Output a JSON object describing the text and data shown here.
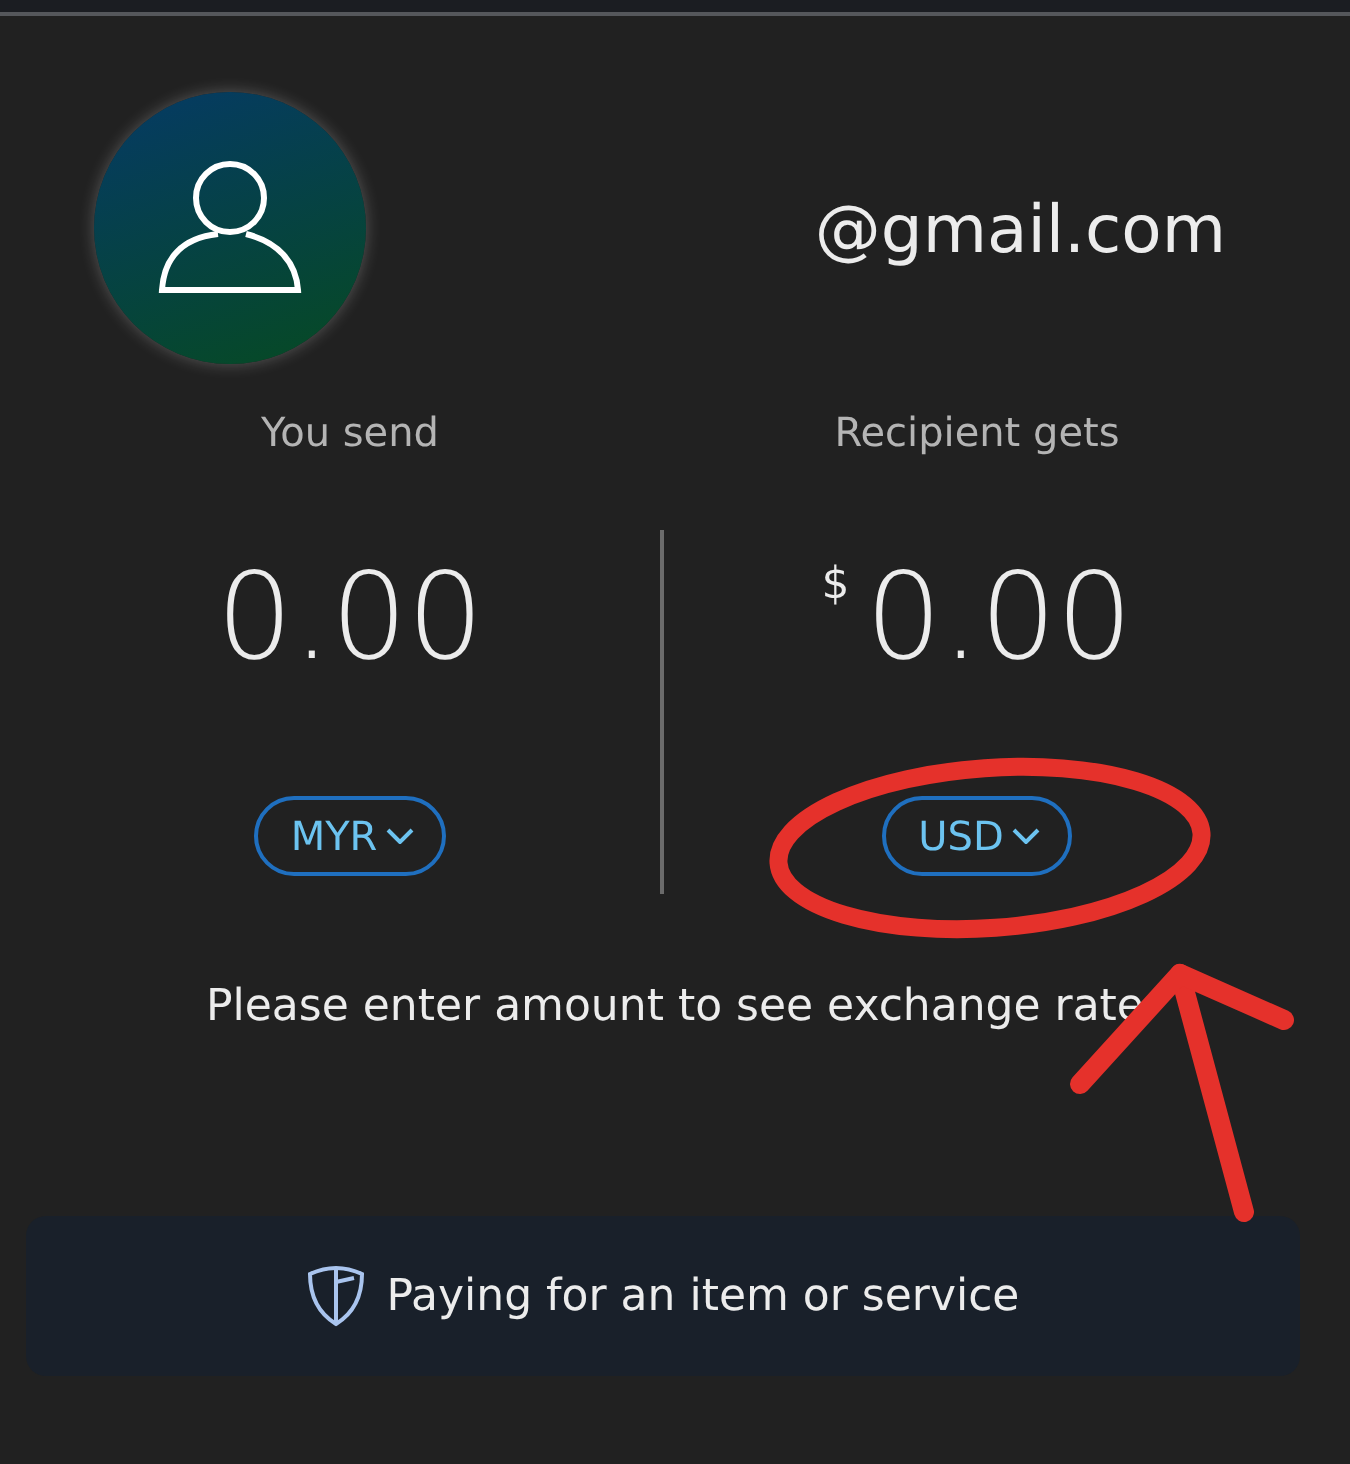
{
  "recipient_email": "@gmail.com",
  "send": {
    "label": "You send",
    "amount": "0.00",
    "currency": "MYR"
  },
  "receive": {
    "label": "Recipient gets",
    "currency_symbol": "$",
    "amount": "0.00",
    "currency": "USD"
  },
  "message": "Please enter amount to see exchange rate",
  "purpose_button": {
    "label": "Paying for an item or service"
  },
  "annotation": {
    "circle": true,
    "arrow": true
  }
}
